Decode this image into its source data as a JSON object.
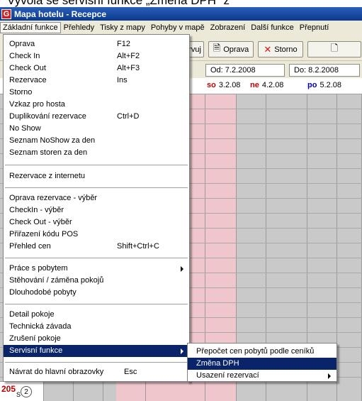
{
  "caption": "Vyvolá se servisní funkce „Změna DPH“ z",
  "window": {
    "title": "Mapa hotelu - Recepce",
    "icon": "G"
  },
  "menubar": {
    "items": [
      "Základní funkce",
      "Přehledy",
      "Tisky z mapy",
      "Pohyby v mapě",
      "Zobrazení",
      "Další funkce",
      "Přepnutí"
    ]
  },
  "toolbar": {
    "rezervuj": "ervuj",
    "oprava": "Oprava",
    "storno": "Storno"
  },
  "dates": {
    "od": "Od: 7.2.2008",
    "do": "Do: 8.2.2008"
  },
  "days": [
    {
      "dow": "so",
      "date": "3.2.08",
      "color": "#c00000"
    },
    {
      "dow": "ne",
      "date": "4.2.08",
      "color": "#c00000"
    },
    {
      "dow": "po",
      "date": "5.2.08",
      "color": "#0000c0"
    }
  ],
  "room": {
    "number": "205",
    "type": "S",
    "count": "2"
  },
  "menu": {
    "groups": [
      [
        {
          "label": "Oprava",
          "shortcut": "F12"
        },
        {
          "label": "Check In",
          "shortcut": "Alt+F2"
        },
        {
          "label": "Check Out",
          "shortcut": "Alt+F3"
        },
        {
          "label": "Rezervace",
          "shortcut": "Ins"
        },
        {
          "label": "Storno",
          "shortcut": ""
        },
        {
          "label": "Vzkaz pro hosta",
          "shortcut": ""
        },
        {
          "label": "Duplikování rezervace",
          "shortcut": "Ctrl+D"
        },
        {
          "label": "No Show",
          "shortcut": ""
        },
        {
          "label": "Seznam NoShow za den",
          "shortcut": ""
        },
        {
          "label": "Seznam storen za den",
          "shortcut": ""
        }
      ],
      [
        {
          "label": "Rezervace z internetu",
          "shortcut": ""
        }
      ],
      [
        {
          "label": "Oprava rezervace - výběr",
          "shortcut": ""
        },
        {
          "label": "CheckIn - výběr",
          "shortcut": ""
        },
        {
          "label": "Check Out - výběr",
          "shortcut": ""
        },
        {
          "label": "Přiřazení kódu POS",
          "shortcut": ""
        },
        {
          "label": "Přehled cen",
          "shortcut": "Shift+Ctrl+C"
        }
      ],
      [
        {
          "label": "Práce s pobytem",
          "shortcut": "",
          "submenu": true
        },
        {
          "label": "Stěhování / záměna pokojů",
          "shortcut": ""
        },
        {
          "label": "Dlouhodobé pobyty",
          "shortcut": ""
        }
      ],
      [
        {
          "label": "Detail pokoje",
          "shortcut": ""
        },
        {
          "label": "Technická závada",
          "shortcut": ""
        },
        {
          "label": "Zrušení pokoje",
          "shortcut": ""
        },
        {
          "label": "Servisní funkce",
          "shortcut": "",
          "submenu": true,
          "selected": true
        }
      ],
      [
        {
          "label": "Návrat do hlavní obrazovky",
          "shortcut": "Esc"
        }
      ]
    ]
  },
  "submenu": {
    "items": [
      {
        "label": "Přepočet cen pobytů podle ceníků"
      },
      {
        "label": "Změna DPH",
        "selected": true
      },
      {
        "label": "Usazení rezervací",
        "submenu": true
      }
    ]
  }
}
